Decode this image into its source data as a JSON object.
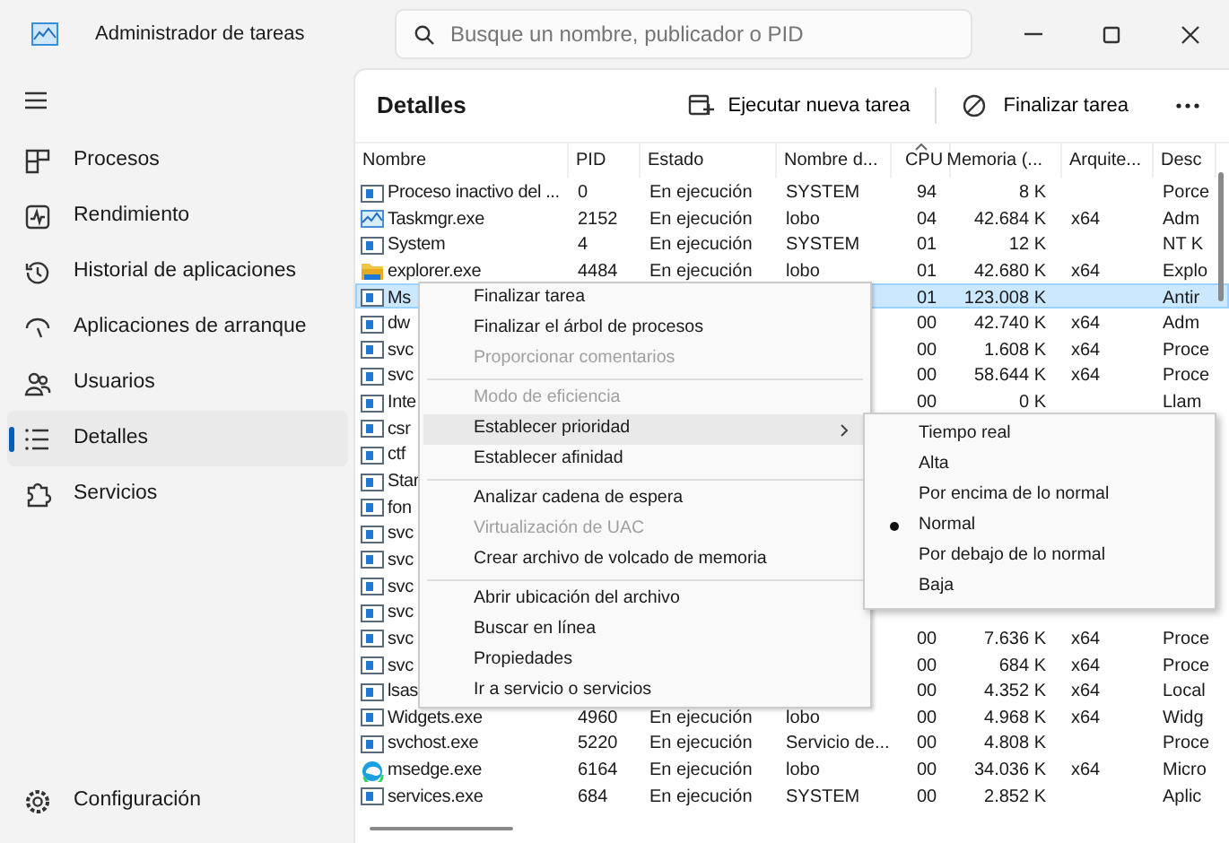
{
  "window": {
    "title": "Administrador de tareas",
    "search": {
      "placeholder": "Busque un nombre, publicador o PID"
    }
  },
  "sidebar": {
    "items": [
      {
        "label": "Procesos",
        "selected": false
      },
      {
        "label": "Rendimiento",
        "selected": false
      },
      {
        "label": "Historial de aplicaciones",
        "selected": false
      },
      {
        "label": "Aplicaciones de arranque",
        "selected": false
      },
      {
        "label": "Usuarios",
        "selected": false
      },
      {
        "label": "Detalles",
        "selected": true
      },
      {
        "label": "Servicios",
        "selected": false
      }
    ],
    "footer": "Configuración"
  },
  "page": {
    "title": "Detalles",
    "actions": [
      "Ejecutar nueva tarea",
      "Finalizar tarea"
    ]
  },
  "table": {
    "columns": [
      {
        "label": "Nombre",
        "sorted": false
      },
      {
        "label": "PID",
        "sorted": false
      },
      {
        "label": "Estado",
        "sorted": false
      },
      {
        "label": "Nombre d...",
        "sorted": false
      },
      {
        "label": "CPU",
        "sorted": true
      },
      {
        "label": "Memoria (...",
        "sorted": false
      },
      {
        "label": "Arquite...",
        "sorted": false
      },
      {
        "label": "Desc",
        "sorted": false
      }
    ],
    "rows": [
      {
        "kind": "app",
        "selected": false,
        "cells": [
          "Proceso inactivo del ...",
          "0",
          "En ejecución",
          "SYSTEM",
          "94",
          "8 K",
          "",
          "Porce"
        ]
      },
      {
        "kind": "monitor",
        "selected": false,
        "cells": [
          "Taskmgr.exe",
          "2152",
          "En ejecución",
          "lobo",
          "04",
          "42.684 K",
          "x64",
          "Adm"
        ]
      },
      {
        "kind": "app",
        "selected": false,
        "cells": [
          "System",
          "4",
          "En ejecución",
          "SYSTEM",
          "01",
          "12 K",
          "",
          "NT K"
        ]
      },
      {
        "kind": "folder",
        "selected": false,
        "cells": [
          "explorer.exe",
          "4484",
          "En ejecución",
          "lobo",
          "01",
          "42.680 K",
          "x64",
          "Explo"
        ]
      },
      {
        "kind": "app",
        "selected": true,
        "cells": [
          "Ms",
          "",
          "",
          "",
          "01",
          "123.008 K",
          "",
          "Antir"
        ]
      },
      {
        "kind": "app",
        "selected": false,
        "cells": [
          "dw",
          "",
          "",
          "",
          "00",
          "42.740 K",
          "x64",
          "Adm"
        ]
      },
      {
        "kind": "app",
        "selected": false,
        "cells": [
          "svc",
          "",
          "",
          "",
          "00",
          "1.608 K",
          "x64",
          "Proce"
        ]
      },
      {
        "kind": "app",
        "selected": false,
        "cells": [
          "svc",
          "",
          "",
          "",
          "00",
          "58.644 K",
          "x64",
          "Proce"
        ]
      },
      {
        "kind": "app",
        "selected": false,
        "cells": [
          "Inte",
          "",
          "",
          "",
          "00",
          "0 K",
          "",
          "Llam"
        ]
      },
      {
        "kind": "app",
        "selected": false,
        "cells": [
          "csr",
          "",
          "",
          "",
          "",
          "",
          "",
          ""
        ]
      },
      {
        "kind": "app",
        "selected": false,
        "cells": [
          "ctf",
          "",
          "",
          "",
          "",
          "",
          "",
          ""
        ]
      },
      {
        "kind": "app",
        "selected": false,
        "cells": [
          "Star",
          "",
          "",
          "",
          "",
          "",
          "",
          ""
        ]
      },
      {
        "kind": "app",
        "selected": false,
        "cells": [
          "fon",
          "",
          "",
          "",
          "",
          "",
          "",
          ""
        ]
      },
      {
        "kind": "app",
        "selected": false,
        "cells": [
          "svc",
          "",
          "",
          "",
          "",
          "",
          "",
          ""
        ]
      },
      {
        "kind": "app",
        "selected": false,
        "cells": [
          "svc",
          "",
          "",
          "",
          "",
          "",
          "",
          ""
        ]
      },
      {
        "kind": "app",
        "selected": false,
        "cells": [
          "svc",
          "",
          "",
          "",
          "",
          "",
          "",
          ""
        ]
      },
      {
        "kind": "app",
        "selected": false,
        "cells": [
          "svc",
          "",
          "",
          "",
          "",
          "",
          "",
          ""
        ]
      },
      {
        "kind": "app",
        "selected": false,
        "cells": [
          "svc",
          "",
          "",
          "",
          "00",
          "7.636 K",
          "x64",
          "Proce"
        ]
      },
      {
        "kind": "app",
        "selected": false,
        "cells": [
          "svc",
          "",
          "",
          "",
          "00",
          "684 K",
          "x64",
          "Proce"
        ]
      },
      {
        "kind": "app",
        "selected": false,
        "cells": [
          "lsas",
          "",
          "",
          "",
          "00",
          "4.352 K",
          "x64",
          "Local"
        ]
      },
      {
        "kind": "app",
        "selected": false,
        "cells": [
          "Widgets.exe",
          "4960",
          "En ejecución",
          "lobo",
          "00",
          "4.968 K",
          "x64",
          "Widg"
        ]
      },
      {
        "kind": "app",
        "selected": false,
        "cells": [
          "svchost.exe",
          "5220",
          "En ejecución",
          "Servicio de...",
          "00",
          "4.808 K",
          "",
          "Proce"
        ]
      },
      {
        "kind": "browser",
        "selected": false,
        "cells": [
          "msedge.exe",
          "6164",
          "En ejecución",
          "lobo",
          "00",
          "34.036 K",
          "x64",
          "Micro"
        ]
      },
      {
        "kind": "app",
        "selected": false,
        "cells": [
          "services.exe",
          "684",
          "En ejecución",
          "SYSTEM",
          "00",
          "2.852 K",
          "",
          "Aplic"
        ]
      }
    ]
  },
  "context_menu": {
    "items": [
      {
        "kind": "item",
        "label": "Finalizar tarea",
        "disabled": false,
        "selected": false,
        "submenu": false
      },
      {
        "kind": "item",
        "label": "Finalizar el árbol de procesos",
        "disabled": false,
        "selected": false,
        "submenu": false
      },
      {
        "kind": "item",
        "label": "Proporcionar comentarios",
        "disabled": true,
        "selected": false,
        "submenu": false
      },
      {
        "kind": "separator"
      },
      {
        "kind": "item",
        "label": "Modo de eficiencia",
        "disabled": true,
        "selected": false,
        "submenu": false
      },
      {
        "kind": "item",
        "label": "Establecer prioridad",
        "disabled": false,
        "selected": true,
        "submenu": true
      },
      {
        "kind": "item",
        "label": "Establecer afinidad",
        "disabled": false,
        "selected": false,
        "submenu": false
      },
      {
        "kind": "separator"
      },
      {
        "kind": "item",
        "label": "Analizar cadena de espera",
        "disabled": false,
        "selected": false,
        "submenu": false
      },
      {
        "kind": "item",
        "label": "Virtualización de UAC",
        "disabled": true,
        "selected": false,
        "submenu": false
      },
      {
        "kind": "item",
        "label": "Crear archivo de volcado de memoria",
        "disabled": false,
        "selected": false,
        "submenu": false
      },
      {
        "kind": "separator"
      },
      {
        "kind": "item",
        "label": "Abrir ubicación del archivo",
        "disabled": false,
        "selected": false,
        "submenu": false
      },
      {
        "kind": "item",
        "label": "Buscar en línea",
        "disabled": false,
        "selected": false,
        "submenu": false
      },
      {
        "kind": "item",
        "label": "Propiedades",
        "disabled": false,
        "selected": false,
        "submenu": false
      },
      {
        "kind": "item",
        "label": "Ir a servicio o servicios",
        "disabled": false,
        "selected": false,
        "submenu": false
      }
    ]
  },
  "submenu": {
    "items": [
      {
        "label": "Tiempo real",
        "checked": false
      },
      {
        "label": "Alta",
        "checked": false
      },
      {
        "label": "Por encima de lo normal",
        "checked": false
      },
      {
        "label": "Normal",
        "checked": true
      },
      {
        "label": "Por debajo de lo normal",
        "checked": false
      },
      {
        "label": "Baja",
        "checked": false
      }
    ]
  }
}
